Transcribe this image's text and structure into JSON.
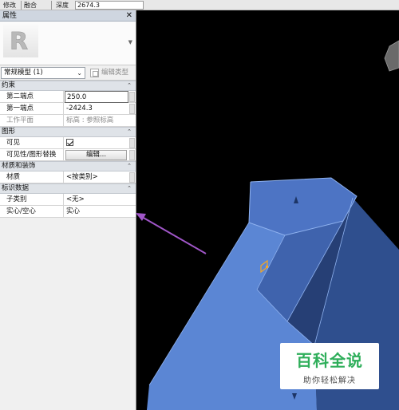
{
  "options_bar": {
    "modify_label": "修改",
    "blend_label": "融合",
    "depth_label": "深度",
    "depth_value": "2674.3"
  },
  "palette": {
    "title": "属性",
    "close_glyph": "✕",
    "type_selector": "常规模型 (1)",
    "edit_type_label": "编辑类型",
    "logo_letter": "R"
  },
  "sections": {
    "constraints": {
      "title": "约束",
      "rows": [
        {
          "label": "第二端点",
          "value": "250.0"
        },
        {
          "label": "第一端点",
          "value": "-2424.3"
        },
        {
          "label": "工作平面",
          "value": "标高 : 参照标高"
        }
      ]
    },
    "graphics": {
      "title": "图形",
      "rows": [
        {
          "label": "可见",
          "value": ""
        },
        {
          "label": "可见性/图形替换",
          "value": "编辑..."
        }
      ]
    },
    "materials": {
      "title": "材质和装饰",
      "rows": [
        {
          "label": "材质",
          "value": "<按类别>"
        }
      ]
    },
    "identity": {
      "title": "标识数据",
      "rows": [
        {
          "label": "子类别",
          "value": "<无>"
        },
        {
          "label": "实心/空心",
          "value": "实心"
        }
      ]
    }
  },
  "watermark": {
    "title": "百科全说",
    "subtitle": "助你轻松解决"
  },
  "colors": {
    "viewport_bg": "#000000",
    "model_face_light": "#5b86d4",
    "model_face_dark": "#2f4f8e",
    "annotation_arrow": "#a056c8",
    "watermark_green": "#2eae5a"
  }
}
